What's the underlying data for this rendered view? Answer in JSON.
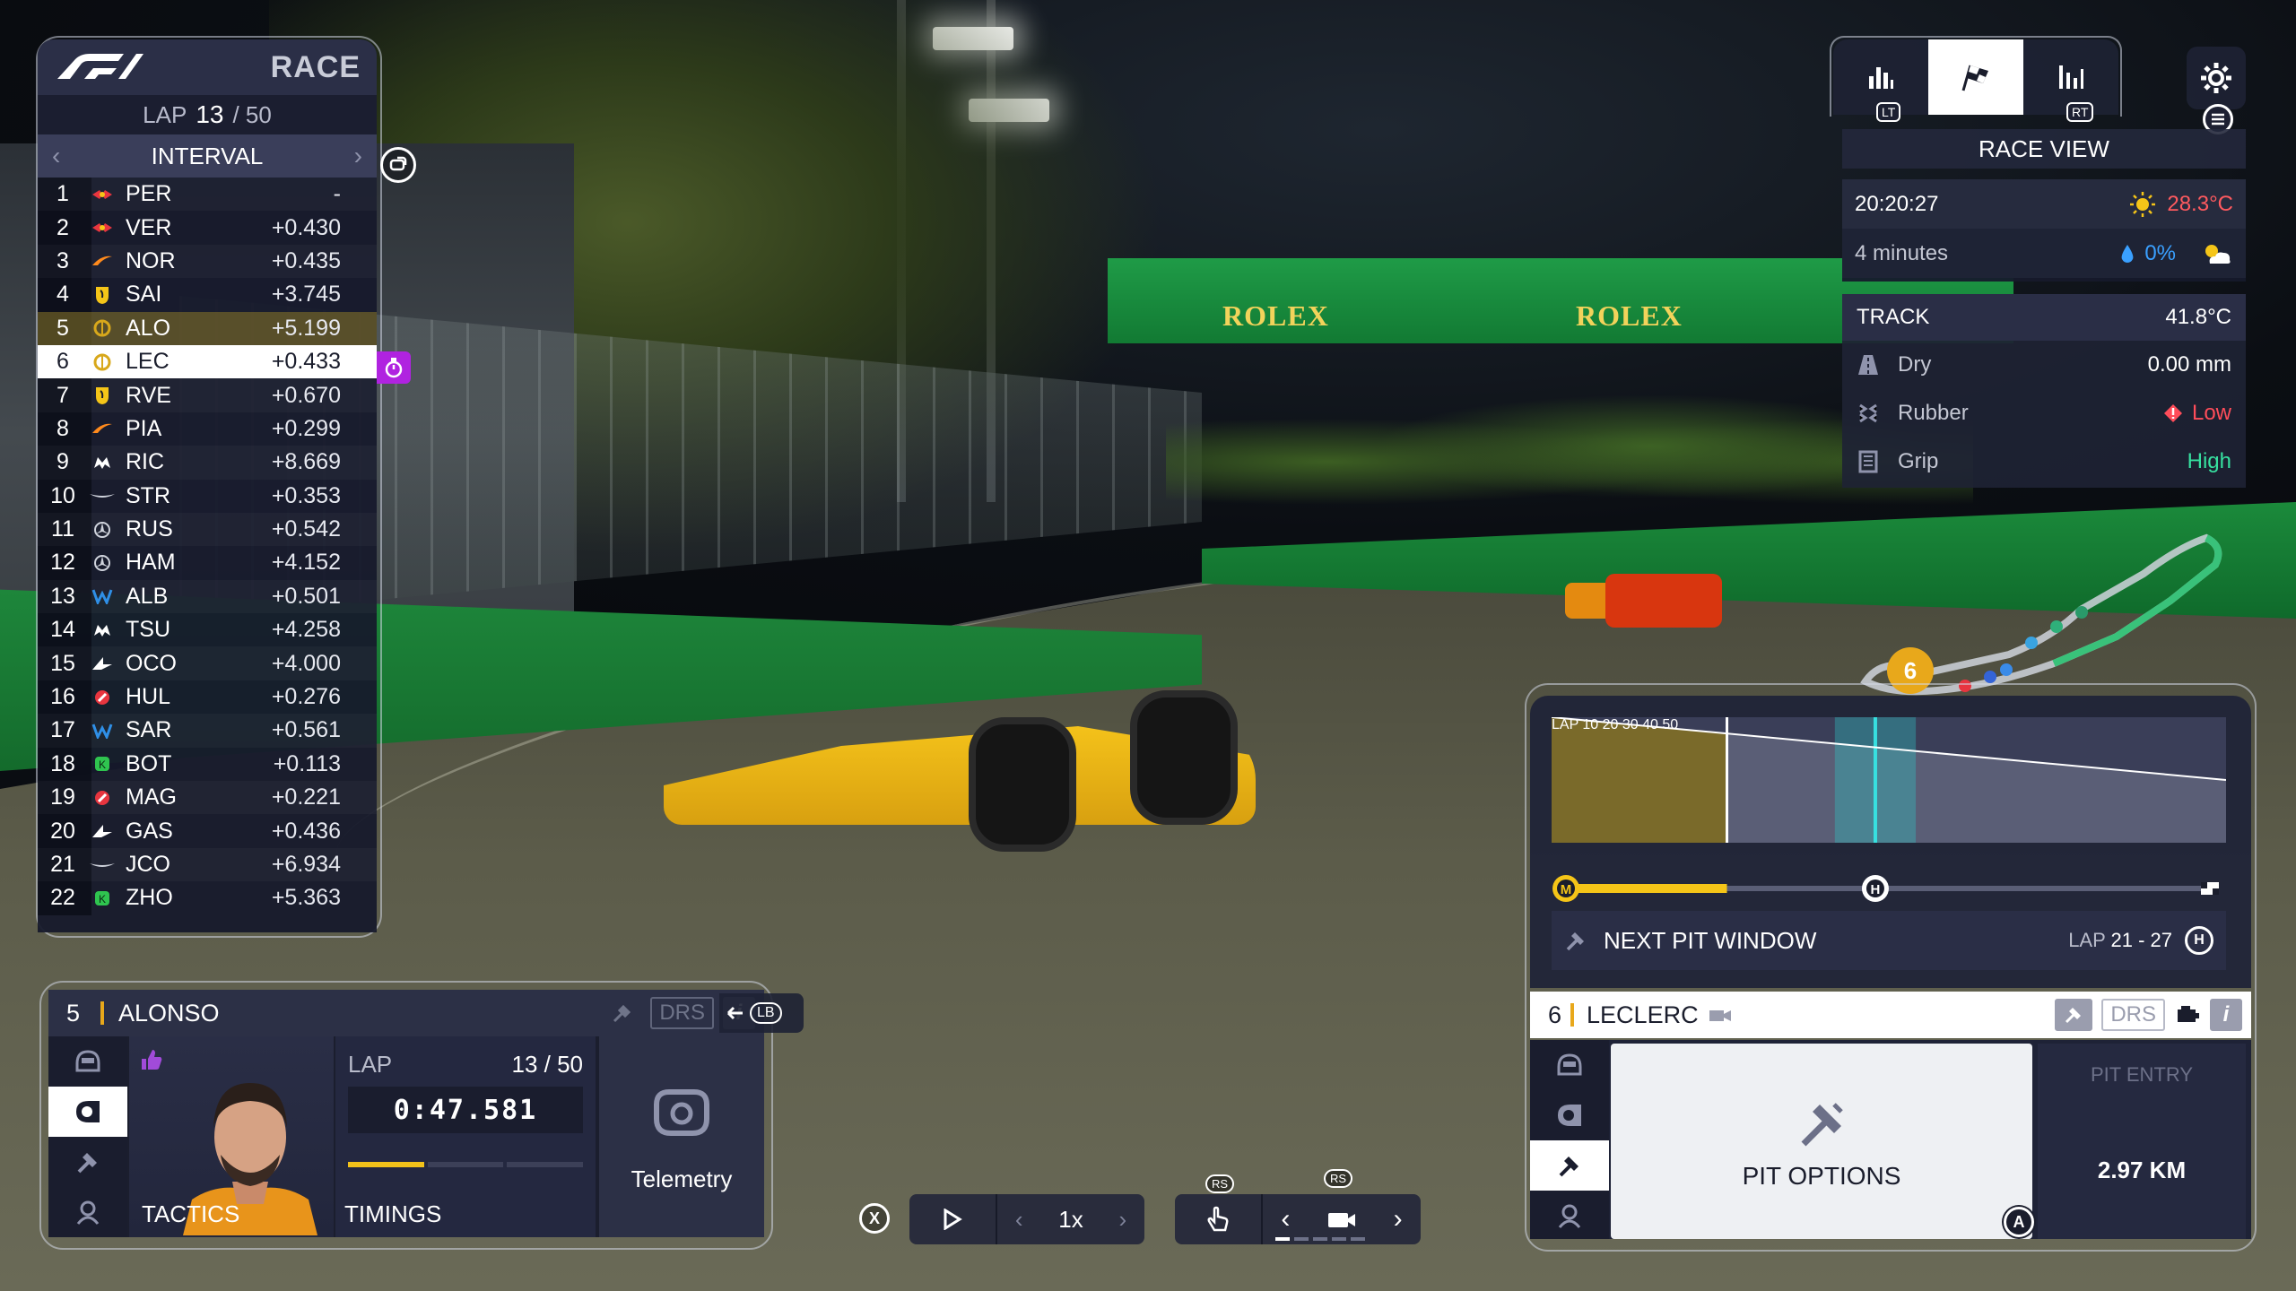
{
  "leaderboard": {
    "header": "RACE",
    "lap_label": "LAP",
    "lap_current": "13",
    "lap_total": "/ 50",
    "mode": "INTERVAL",
    "rows": [
      {
        "pos": "1",
        "code": "PER",
        "gap": "-",
        "team": "redbull"
      },
      {
        "pos": "2",
        "code": "VER",
        "gap": "+0.430",
        "team": "redbull"
      },
      {
        "pos": "3",
        "code": "NOR",
        "gap": "+0.435",
        "team": "mclaren"
      },
      {
        "pos": "4",
        "code": "SAI",
        "gap": "+3.745",
        "team": "ferrari"
      },
      {
        "pos": "5",
        "code": "ALO",
        "gap": "+5.199",
        "team": "custom"
      },
      {
        "pos": "6",
        "code": "LEC",
        "gap": "+0.433",
        "team": "custom"
      },
      {
        "pos": "7",
        "code": "RVE",
        "gap": "+0.670",
        "team": "ferrari"
      },
      {
        "pos": "8",
        "code": "PIA",
        "gap": "+0.299",
        "team": "mclaren"
      },
      {
        "pos": "9",
        "code": "RIC",
        "gap": "+8.669",
        "team": "rb"
      },
      {
        "pos": "10",
        "code": "STR",
        "gap": "+0.353",
        "team": "astonmartin"
      },
      {
        "pos": "11",
        "code": "RUS",
        "gap": "+0.542",
        "team": "mercedes"
      },
      {
        "pos": "12",
        "code": "HAM",
        "gap": "+4.152",
        "team": "mercedes"
      },
      {
        "pos": "13",
        "code": "ALB",
        "gap": "+0.501",
        "team": "williams"
      },
      {
        "pos": "14",
        "code": "TSU",
        "gap": "+4.258",
        "team": "rb"
      },
      {
        "pos": "15",
        "code": "OCO",
        "gap": "+4.000",
        "team": "alpine"
      },
      {
        "pos": "16",
        "code": "HUL",
        "gap": "+0.276",
        "team": "haas"
      },
      {
        "pos": "17",
        "code": "SAR",
        "gap": "+0.561",
        "team": "williams"
      },
      {
        "pos": "18",
        "code": "BOT",
        "gap": "+0.113",
        "team": "sauber"
      },
      {
        "pos": "19",
        "code": "MAG",
        "gap": "+0.221",
        "team": "haas"
      },
      {
        "pos": "20",
        "code": "GAS",
        "gap": "+0.436",
        "team": "alpine"
      },
      {
        "pos": "21",
        "code": "JCO",
        "gap": "+6.934",
        "team": "astonmartin"
      },
      {
        "pos": "22",
        "code": "ZHO",
        "gap": "+5.363",
        "team": "sauber"
      }
    ]
  },
  "driver_panel": {
    "number": "5",
    "name": "ALONSO",
    "drs_label": "DRS",
    "lb_label": "LB",
    "tactics_label": "TACTICS",
    "lap_label": "LAP",
    "lap_value": "13 / 50",
    "lap_time": "0:47.581",
    "timings_label": "TIMINGS",
    "telemetry_label": "Telemetry"
  },
  "controls": {
    "x_label": "X",
    "speed": "1x",
    "rs_label": "RS"
  },
  "view": {
    "lt_label": "LT",
    "rt_label": "RT",
    "title": "RACE VIEW"
  },
  "weather": {
    "time": "20:20:27",
    "air_temp": "28.3°C",
    "forecast": "4 minutes",
    "rain_chance": "0%"
  },
  "track": {
    "label": "TRACK",
    "temp": "41.8°C",
    "rows": [
      {
        "label": "Dry",
        "value": "0.00 mm"
      },
      {
        "label": "Rubber",
        "value": "Low"
      },
      {
        "label": "Grip",
        "value": "High"
      }
    ]
  },
  "minimap": {
    "me_position": "6"
  },
  "strategy": {
    "axis": [
      "LAP",
      "10",
      "20",
      "30",
      "40",
      "50"
    ],
    "pit_window_label": "NEXT PIT WINDOW",
    "pit_window_lap_label": "LAP",
    "pit_window_range": "21 - 27",
    "compound_start": "M",
    "compound_next": "H",
    "stint_progress_laps": 13,
    "total_laps": 50,
    "pit_window_start": 21,
    "pit_window_end": 27
  },
  "right_panel": {
    "number": "6",
    "name": "LECLERC",
    "drs_label": "DRS",
    "pit_options_label": "PIT OPTIONS",
    "a_label": "A",
    "pit_entry_label": "PIT ENTRY",
    "pit_entry_value": "2.97 KM"
  },
  "colors": {
    "panel": "#161a2c",
    "accent_yellow": "#e8a81b",
    "purple": "#b023e0",
    "low_red": "#ff4d5a",
    "high_green": "#37e0a0",
    "rain_blue": "#3aa0ff"
  }
}
